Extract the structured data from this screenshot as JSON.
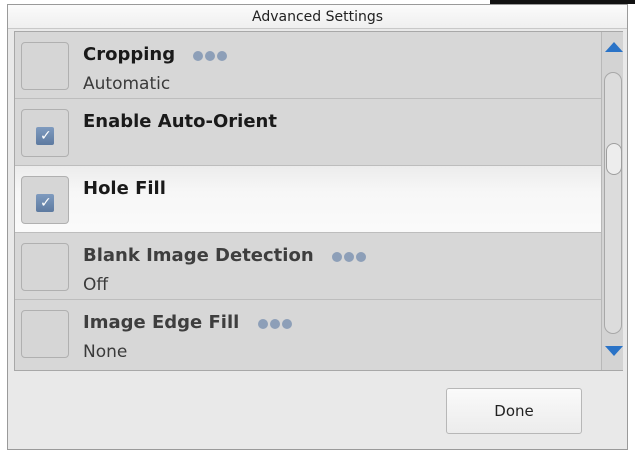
{
  "dialog": {
    "title": "Advanced Settings"
  },
  "settings": {
    "items": [
      {
        "label": "Cropping",
        "value": "Automatic",
        "checked": false,
        "has_options": true,
        "selected": false
      },
      {
        "label": "Enable Auto-Orient",
        "value": "",
        "checked": true,
        "has_options": false,
        "selected": false
      },
      {
        "label": "Hole Fill",
        "value": "",
        "checked": true,
        "has_options": false,
        "selected": true
      },
      {
        "label": "Blank Image Detection",
        "value": "Off",
        "checked": false,
        "has_options": true,
        "selected": false
      },
      {
        "label": "Image Edge Fill",
        "value": "None",
        "checked": false,
        "has_options": true,
        "selected": false
      }
    ]
  },
  "scrollbar": {
    "up_icon": "triangle-up-icon",
    "down_icon": "triangle-down-icon",
    "accent": "#2a73c7"
  },
  "footer": {
    "done_label": "Done"
  }
}
